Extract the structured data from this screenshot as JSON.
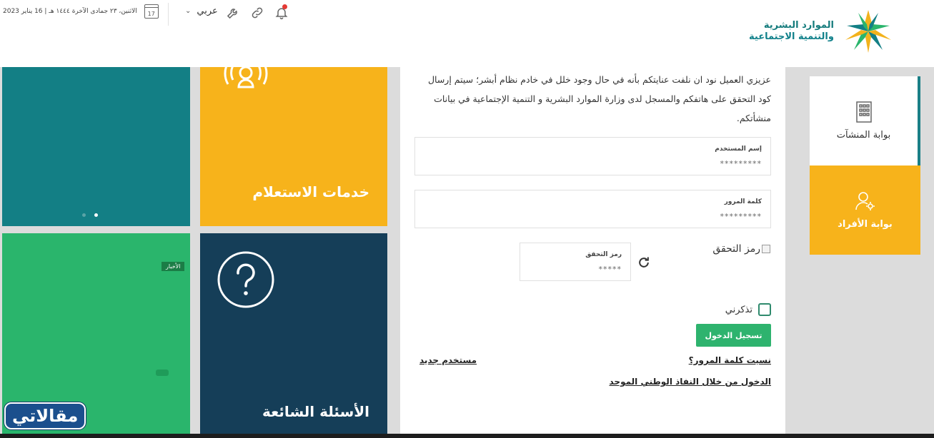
{
  "header": {
    "date": "الاثنين، ٢٣ جمادى الآخرة ١٤٤٤ هـ | 16 يناير 2023",
    "calendar_day": "17",
    "language": "عربي",
    "logo_line1": "الموارد البشرية",
    "logo_line2": "والتنمية الاجتماعية"
  },
  "tiles": {
    "inquiry_title": "خدمات الاستعلام",
    "faq_title": "الأسئلة الشائعة",
    "news_badge": "الأخبار"
  },
  "form": {
    "intro": "عزيزي العميل نود ان نلفت عنايتكم بأنه في حال وجود خلل في خادم نظام أبشر؛ سيتم إرسال كود التحقق على هاتفكم والمسجل لدى وزارة الموارد البشرية و التنمية الإجتماعية في بيانات منشأتكم.",
    "username_label": "إسم المستخدم",
    "username_value": "*********",
    "password_label": "كلمة المرور",
    "password_value": "*********",
    "captcha_alt": "رمز التحقق",
    "captcha_label": "رمز التحقق",
    "captcha_value": "*****",
    "remember_label": "تذكرني",
    "login_button": "تسجيل الدخول",
    "forgot_password": "نسيت كلمة المرور؟",
    "new_user": "مستخدم جديد",
    "nafath_login": "الدخول من خلال النفاذ الوطني الموحد"
  },
  "side": {
    "establishments": "بوابة المنشآت",
    "individuals": "بوابة الأفراد"
  },
  "watermark": "مقالاتي",
  "colors": {
    "teal": "#137f85",
    "yellow": "#f7b31b",
    "green": "#2ab56c",
    "navy": "#153e58",
    "button_green": "#2eb36e"
  }
}
